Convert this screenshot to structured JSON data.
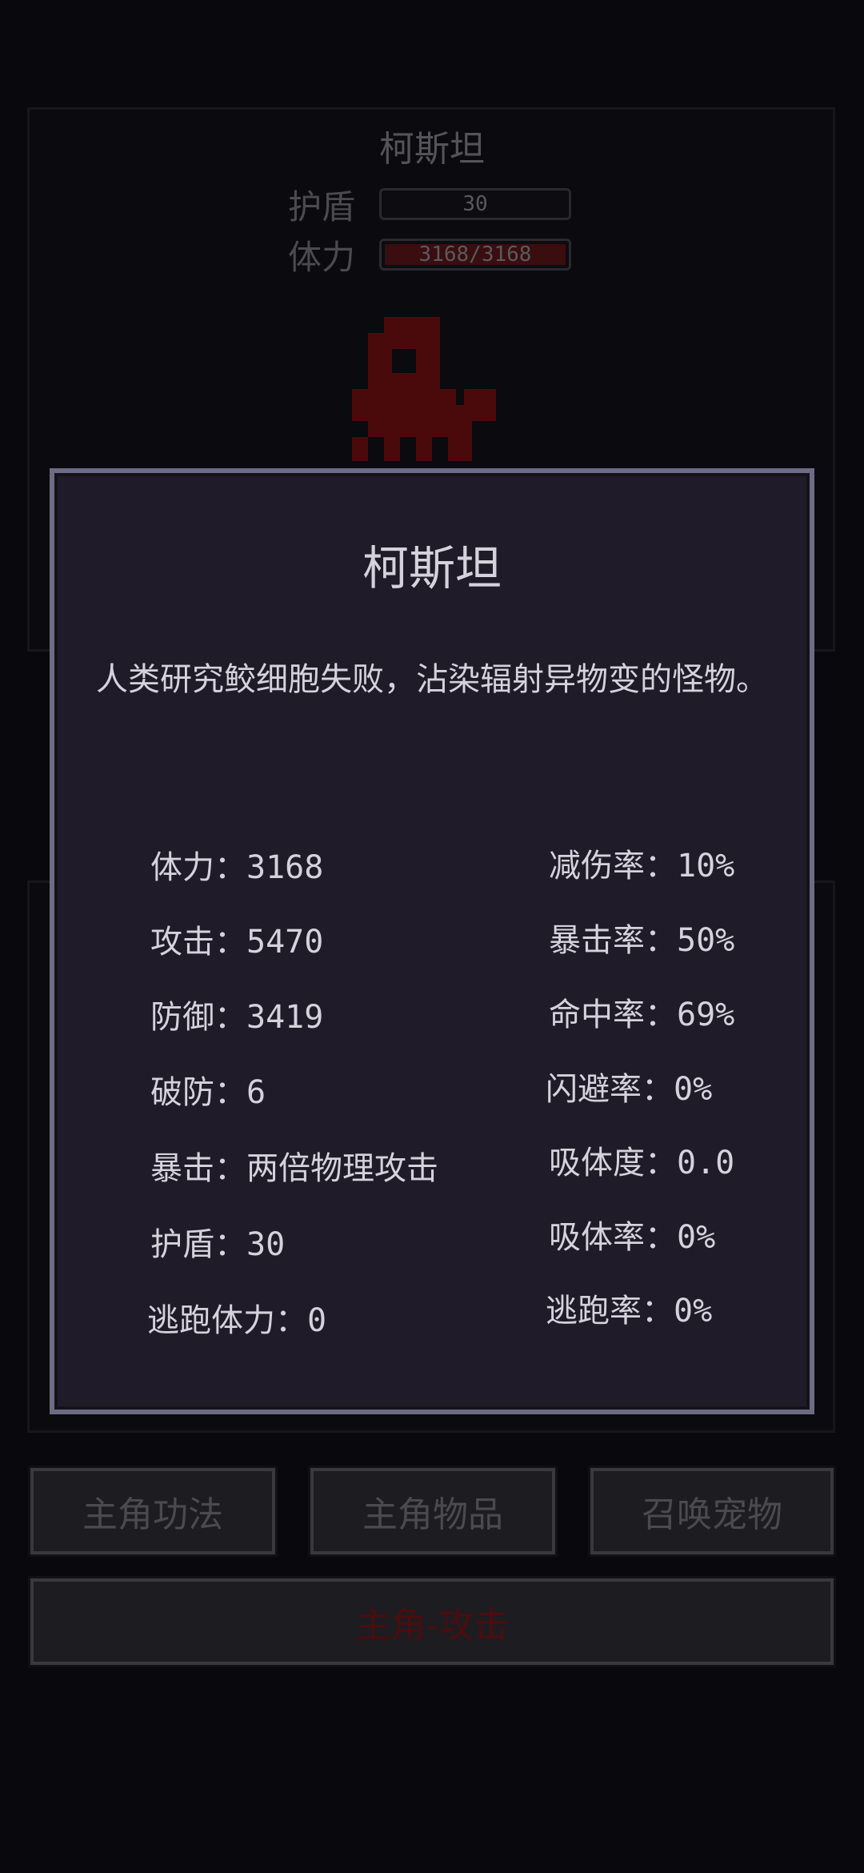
{
  "enemy": {
    "name": "柯斯坦",
    "shield_label": "护盾",
    "shield_value": "30",
    "hp_label": "体力",
    "hp_value": "3168/3168",
    "hp_fraction": 1.0
  },
  "buttons": {
    "skills": "主角功法",
    "items": "主角物品",
    "summon_pet": "召唤宠物",
    "attack": "主角-攻击"
  },
  "modal": {
    "title": "柯斯坦",
    "description": "人类研究鲛细胞失败，沾染辐射异物变的怪物。",
    "left_stats": [
      {
        "label": "体力：",
        "value": "3168"
      },
      {
        "label": "攻击：",
        "value": "5470"
      },
      {
        "label": "防御：",
        "value": "3419"
      },
      {
        "label": "破防：",
        "value": "6"
      },
      {
        "label": "暴击：",
        "value": "两倍物理攻击"
      },
      {
        "label": "护盾：",
        "value": "30"
      },
      {
        "label": "逃跑体力：",
        "value": "0"
      }
    ],
    "right_stats": [
      {
        "label": "减伤率：",
        "value": "10%"
      },
      {
        "label": "暴击率：",
        "value": "50%"
      },
      {
        "label": "命中率：",
        "value": "69%"
      },
      {
        "label": "闪避率：",
        "value": "0%"
      },
      {
        "label": "吸体度：",
        "value": "0.0"
      },
      {
        "label": "吸体率：",
        "value": "0%"
      },
      {
        "label": "逃跑率：",
        "value": "0%"
      }
    ]
  },
  "colors": {
    "background": "#09080c",
    "modal_background": "#1f1b28",
    "modal_border": "#6e6b84",
    "text": "#d4d2dc",
    "monster": "#4a0a0c",
    "attack_text": "#4a0d0e"
  },
  "icons": {
    "monster_sprite": "octopus-monster-sprite"
  }
}
